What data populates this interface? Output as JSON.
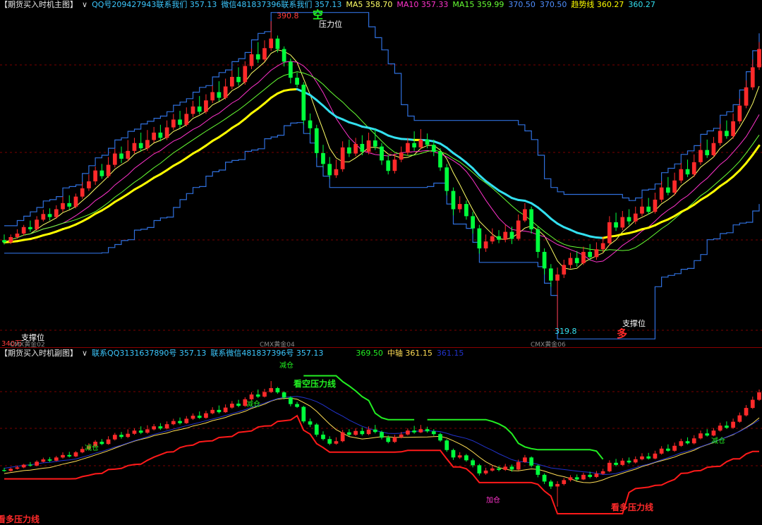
{
  "main_header": {
    "title": "【期货买入时机主图】",
    "dropdown": "∨",
    "qq": "QQ号209427943联系我们 357.13",
    "wx": "微信481837396联系我们 357.13",
    "ma5": "MA5 358.70",
    "ma10": "MA10 357.33",
    "ma15": "MA15 359.99",
    "v1": "370.50",
    "v2": "370.50",
    "trend": "趋势线 360.27",
    "v3": "360.27"
  },
  "sub_header": {
    "title": "【期货买入时机副图】",
    "dropdown": "∨",
    "qq": "联系QQ3131637890号 357.13",
    "wx": "联系微信481837396号 357.13",
    "v1": "369.50",
    "axis": "中轴 361.15",
    "v2": "361.15"
  },
  "colors": {
    "up": "#ff2a2a",
    "down": "#00ff3c",
    "ma5": "#ffff66",
    "ma10": "#ff33cc",
    "ma15": "#66ff33",
    "trend": "#ffff00",
    "trend_down": "#33e0f0",
    "band": "#2f6fdc",
    "support_red": "#ff1a1a",
    "pressure_green": "#22ee22",
    "mid_blue": "#2233cc",
    "mid_yellow": "#ffdd55"
  },
  "annotations": {
    "high": "390.8",
    "low": "319.8",
    "short_signal": "空",
    "long_signal": "多",
    "pressure": "压力位",
    "support_a": "支撑位",
    "support_b": "支撑位",
    "start_val": "340万",
    "contract_a": "CMX黄金02",
    "contract_b": "CMX黄金04",
    "contract_c": "CMX黄金06",
    "sub_short_pressure": "看空压力线",
    "sub_long_pressure_a": "看多压力线",
    "sub_long_pressure_b": "看多压力线",
    "reduce": "减仓",
    "add": "加仓"
  },
  "chart_data": {
    "type": "candlestick",
    "y_range_main": [
      319.8,
      390.8
    ],
    "candles": [
      [
        340.5,
        340.0,
        341.8,
        339.5
      ],
      [
        340.0,
        341.2,
        341.8,
        339.6
      ],
      [
        341.2,
        342.0,
        343.0,
        340.8
      ],
      [
        342.0,
        343.5,
        344.0,
        341.5
      ],
      [
        343.5,
        343.0,
        345.0,
        342.4
      ],
      [
        343.0,
        345.2,
        346.0,
        342.6
      ],
      [
        345.2,
        346.5,
        347.5,
        344.8
      ],
      [
        346.5,
        345.8,
        347.8,
        345.0
      ],
      [
        345.8,
        347.6,
        348.5,
        345.4
      ],
      [
        347.6,
        349.0,
        350.5,
        347.0
      ],
      [
        349.0,
        348.2,
        350.8,
        347.6
      ],
      [
        348.2,
        350.5,
        351.2,
        347.8
      ],
      [
        350.5,
        352.4,
        353.8,
        350.0
      ],
      [
        352.4,
        354.0,
        355.6,
        351.8
      ],
      [
        354.0,
        356.5,
        357.4,
        353.2
      ],
      [
        356.5,
        355.2,
        358.0,
        354.6
      ],
      [
        355.2,
        357.8,
        359.6,
        354.8
      ],
      [
        357.8,
        360.4,
        361.5,
        357.2
      ],
      [
        360.4,
        359.2,
        362.0,
        358.2
      ],
      [
        359.2,
        361.0,
        363.5,
        358.6
      ],
      [
        361.0,
        362.8,
        364.0,
        360.4
      ],
      [
        362.8,
        361.6,
        365.2,
        360.8
      ],
      [
        361.6,
        363.5,
        365.8,
        361.0
      ],
      [
        363.5,
        365.2,
        366.5,
        362.9
      ],
      [
        365.2,
        364.0,
        367.0,
        363.2
      ],
      [
        364.0,
        366.4,
        368.0,
        363.5
      ],
      [
        366.4,
        368.2,
        369.5,
        365.8
      ],
      [
        368.2,
        367.0,
        370.2,
        366.2
      ],
      [
        367.0,
        369.5,
        371.0,
        366.6
      ],
      [
        369.5,
        371.2,
        372.5,
        368.8
      ],
      [
        371.2,
        370.0,
        373.6,
        369.4
      ],
      [
        370.0,
        372.6,
        374.0,
        369.5
      ],
      [
        372.6,
        374.5,
        376.0,
        372.0
      ],
      [
        374.5,
        373.2,
        377.0,
        372.4
      ],
      [
        373.2,
        375.8,
        377.6,
        372.8
      ],
      [
        375.8,
        378.0,
        379.5,
        375.2
      ],
      [
        378.0,
        376.8,
        380.2,
        376.0
      ],
      [
        376.8,
        380.5,
        381.6,
        376.2
      ],
      [
        380.5,
        383.2,
        384.5,
        379.8
      ],
      [
        383.2,
        382.0,
        386.0,
        381.2
      ],
      [
        382.0,
        384.6,
        386.4,
        381.5
      ],
      [
        384.6,
        386.8,
        390.8,
        384.0
      ],
      [
        386.8,
        384.4,
        387.5,
        383.6
      ],
      [
        384.4,
        381.5,
        385.0,
        380.4
      ],
      [
        381.5,
        377.8,
        382.2,
        376.5
      ],
      [
        377.8,
        376.2,
        379.0,
        375.6
      ],
      [
        376.2,
        368.0,
        376.8,
        367.0
      ],
      [
        368.0,
        366.2,
        369.6,
        364.8
      ],
      [
        366.2,
        360.5,
        367.0,
        359.4
      ],
      [
        360.5,
        358.0,
        362.4,
        357.2
      ],
      [
        358.0,
        355.4,
        359.6,
        354.6
      ],
      [
        355.4,
        356.8,
        359.0,
        354.8
      ],
      [
        356.8,
        361.8,
        363.2,
        356.2
      ],
      [
        361.8,
        360.4,
        363.6,
        359.6
      ],
      [
        360.4,
        362.6,
        364.0,
        359.8
      ],
      [
        362.6,
        360.8,
        364.6,
        360.0
      ],
      [
        360.8,
        363.4,
        365.2,
        360.2
      ],
      [
        363.4,
        362.0,
        366.0,
        361.2
      ],
      [
        362.0,
        358.8,
        362.8,
        357.8
      ],
      [
        358.8,
        356.4,
        360.0,
        355.6
      ],
      [
        356.4,
        359.0,
        360.4,
        355.8
      ],
      [
        359.0,
        360.6,
        362.0,
        358.4
      ],
      [
        360.6,
        362.8,
        364.0,
        360.0
      ],
      [
        362.8,
        361.8,
        365.5,
        361.0
      ],
      [
        361.8,
        363.6,
        366.0,
        361.4
      ],
      [
        363.6,
        362.4,
        365.0,
        361.6
      ],
      [
        362.4,
        360.8,
        363.6,
        359.8
      ],
      [
        360.8,
        357.2,
        361.6,
        356.4
      ],
      [
        357.2,
        351.8,
        358.0,
        350.8
      ],
      [
        351.8,
        347.6,
        352.6,
        346.2
      ],
      [
        347.6,
        348.8,
        350.6,
        346.8
      ],
      [
        348.8,
        346.0,
        349.6,
        345.2
      ],
      [
        346.0,
        343.2,
        347.0,
        342.0
      ],
      [
        343.2,
        338.6,
        344.0,
        337.4
      ],
      [
        338.6,
        340.2,
        341.8,
        337.8
      ],
      [
        340.2,
        341.4,
        343.2,
        339.6
      ],
      [
        341.4,
        340.6,
        342.8,
        339.8
      ],
      [
        340.6,
        342.4,
        344.0,
        340.0
      ],
      [
        342.4,
        340.8,
        343.6,
        339.6
      ],
      [
        340.8,
        345.0,
        346.4,
        340.4
      ],
      [
        345.0,
        347.6,
        349.0,
        344.6
      ],
      [
        347.6,
        343.0,
        348.2,
        342.0
      ],
      [
        343.0,
        337.8,
        343.6,
        336.4
      ],
      [
        337.8,
        334.0,
        338.6,
        332.6
      ],
      [
        334.0,
        331.2,
        335.0,
        329.8
      ],
      [
        331.2,
        332.6,
        334.2,
        319.8
      ],
      [
        332.6,
        334.8,
        336.0,
        331.8
      ],
      [
        334.8,
        336.4,
        337.6,
        334.0
      ],
      [
        336.4,
        335.2,
        338.0,
        334.4
      ],
      [
        335.2,
        337.8,
        339.0,
        334.8
      ],
      [
        337.8,
        336.6,
        339.6,
        335.8
      ],
      [
        336.6,
        338.4,
        340.0,
        336.0
      ],
      [
        338.4,
        339.8,
        341.2,
        337.8
      ],
      [
        339.8,
        344.6,
        346.0,
        339.2
      ],
      [
        344.6,
        343.4,
        346.8,
        342.6
      ],
      [
        343.4,
        345.8,
        347.2,
        342.8
      ],
      [
        345.8,
        344.8,
        347.6,
        344.0
      ],
      [
        344.8,
        346.6,
        348.2,
        344.2
      ],
      [
        346.6,
        348.2,
        350.0,
        346.0
      ],
      [
        348.2,
        347.0,
        350.2,
        346.4
      ],
      [
        347.0,
        349.8,
        351.4,
        346.6
      ],
      [
        349.8,
        352.6,
        354.0,
        349.2
      ],
      [
        352.6,
        351.4,
        355.0,
        350.8
      ],
      [
        351.4,
        354.2,
        356.0,
        350.8
      ],
      [
        354.2,
        356.8,
        358.2,
        353.6
      ],
      [
        356.8,
        355.6,
        359.0,
        355.0
      ],
      [
        355.6,
        358.4,
        360.2,
        355.0
      ],
      [
        358.4,
        361.2,
        362.8,
        357.8
      ],
      [
        361.2,
        360.0,
        363.6,
        359.4
      ],
      [
        360.0,
        362.8,
        364.2,
        359.6
      ],
      [
        362.8,
        365.6,
        367.2,
        362.2
      ],
      [
        365.6,
        364.4,
        368.0,
        363.8
      ],
      [
        364.4,
        367.8,
        369.6,
        363.8
      ],
      [
        367.8,
        371.4,
        373.0,
        367.2
      ],
      [
        371.4,
        375.6,
        377.2,
        370.8
      ],
      [
        375.6,
        380.2,
        382.0,
        375.0
      ],
      [
        380.2,
        384.4,
        386.0,
        379.6
      ]
    ]
  }
}
